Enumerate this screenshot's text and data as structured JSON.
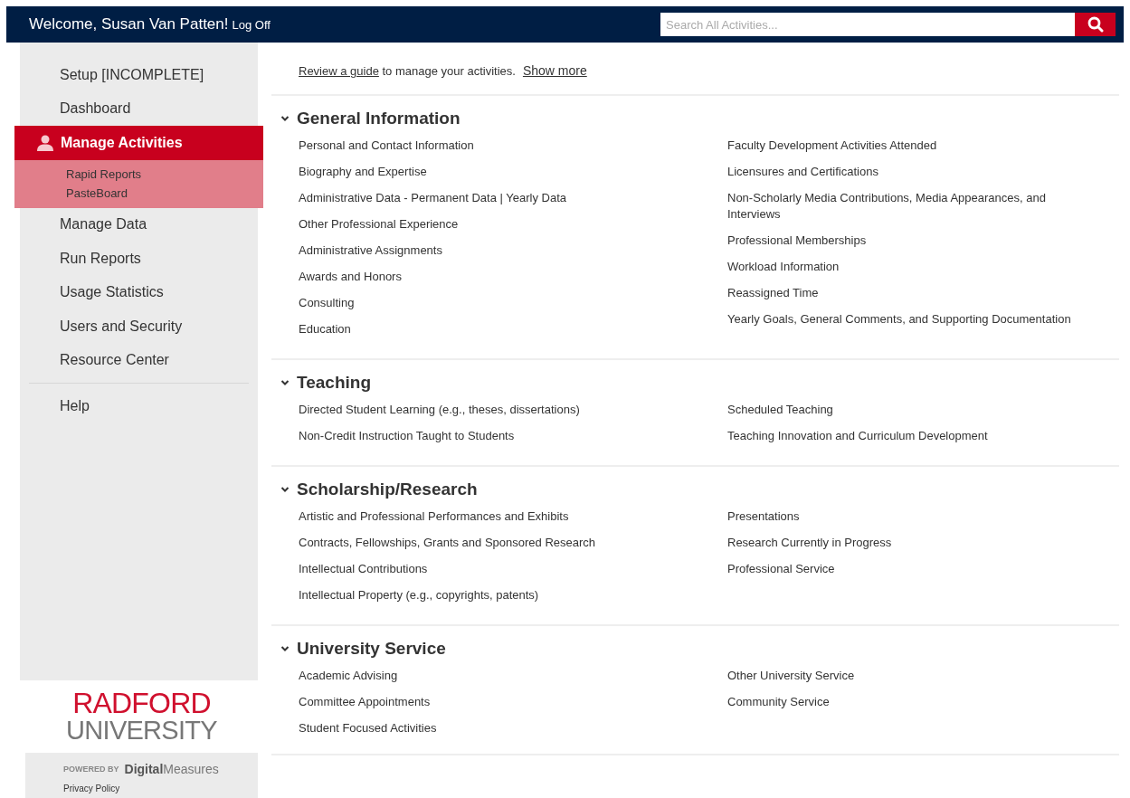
{
  "header": {
    "welcome": "Welcome, Susan Van Patten!",
    "logoff": "Log Off",
    "search": {
      "placeholder": "Search All Activities..."
    }
  },
  "sidebar": {
    "items": [
      {
        "label": "Setup [INCOMPLETE]",
        "selected": false,
        "divider_before": false
      },
      {
        "label": "Dashboard",
        "selected": false,
        "divider_before": false
      },
      {
        "label": "Manage Activities",
        "selected": true,
        "divider_before": false,
        "children": [
          {
            "label": "Rapid Reports"
          },
          {
            "label": "PasteBoard"
          }
        ]
      },
      {
        "label": "Manage Data",
        "selected": false,
        "divider_before": false
      },
      {
        "label": "Run Reports",
        "selected": false,
        "divider_before": false
      },
      {
        "label": "Usage Statistics",
        "selected": false,
        "divider_before": false
      },
      {
        "label": "Users and Security",
        "selected": false,
        "divider_before": false
      },
      {
        "label": "Resource Center",
        "selected": false,
        "divider_before": false
      },
      {
        "label": "Help",
        "selected": false,
        "divider_before": true
      }
    ],
    "logo": {
      "line_1": "RADFORD",
      "line_2": "UNIVERSITY"
    },
    "powered_by": {
      "label": "POWERED BY",
      "brand_bold": "Digital",
      "brand_light": "Measures"
    },
    "privacy_link": "Privacy Policy"
  },
  "intro": {
    "link": "Review a guide",
    "text": " to manage your activities.",
    "show_more": "Show more"
  },
  "sections": [
    {
      "title": "General Information",
      "expanded": true,
      "left": [
        "Personal and Contact Information",
        "Biography and Expertise",
        "Administrative Data - Permanent Data | Yearly Data",
        "Other Professional Experience",
        "Administrative Assignments",
        "Awards and Honors",
        "Consulting",
        "Education"
      ],
      "right": [
        "Faculty Development Activities Attended",
        "Licensures and Certifications",
        "Non-Scholarly Media Contributions, Media Appearances, and Interviews",
        "Professional Memberships",
        "Workload Information",
        "Reassigned Time",
        "Yearly Goals, General Comments, and Supporting Documentation"
      ]
    },
    {
      "title": "Teaching",
      "expanded": true,
      "left": [
        "Directed Student Learning (e.g., theses, dissertations)",
        "Non-Credit Instruction Taught to Students"
      ],
      "right": [
        "Scheduled Teaching",
        "Teaching Innovation and Curriculum Development"
      ]
    },
    {
      "title": "Scholarship/Research",
      "expanded": true,
      "left": [
        "Artistic and Professional Performances and Exhibits",
        "Contracts, Fellowships, Grants and Sponsored Research",
        "Intellectual Contributions",
        "Intellectual Property (e.g., copyrights, patents)"
      ],
      "right": [
        "Presentations",
        "Research Currently in Progress",
        "Professional Service"
      ]
    },
    {
      "title": "University Service",
      "expanded": true,
      "left": [
        "Academic Advising",
        "Committee Appointments",
        "Student Focused Activities"
      ],
      "right": [
        "Other University Service",
        "Community Service"
      ]
    }
  ]
}
